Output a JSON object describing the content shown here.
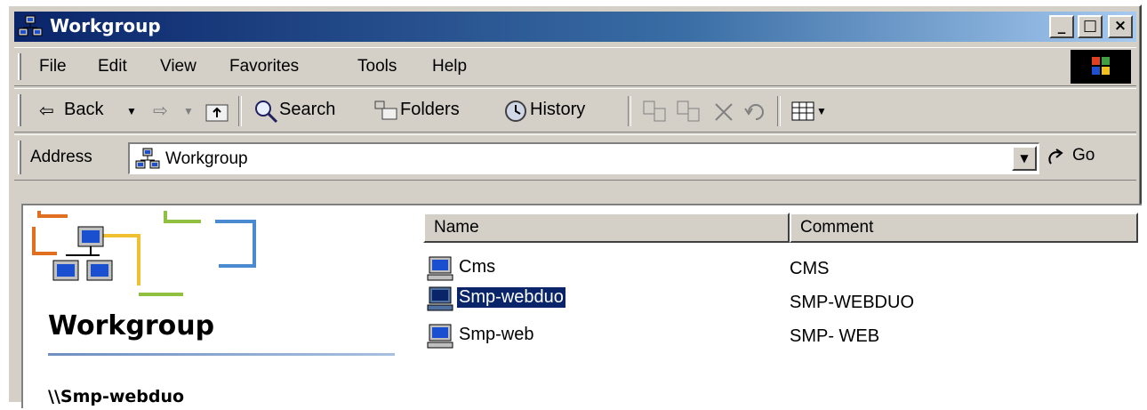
{
  "window": {
    "title": "Workgroup",
    "controls": {
      "minimize": "_",
      "maximize": "□",
      "close": "×"
    }
  },
  "menu": [
    {
      "label": "File"
    },
    {
      "label": "Edit"
    },
    {
      "label": "View"
    },
    {
      "label": "Favorites"
    },
    {
      "label": "Tools"
    },
    {
      "label": "Help"
    }
  ],
  "toolbar": {
    "back_label": "Back",
    "back_icon": "⇦",
    "forward_icon": "⇨",
    "search_label": "Search",
    "folders_label": "Folders",
    "history_label": "History"
  },
  "address": {
    "label": "Address",
    "value": "Workgroup",
    "go_label": "Go"
  },
  "left_pane": {
    "title": "Workgroup",
    "path": "\\\\Smp-webduo"
  },
  "list": {
    "columns": [
      "Name",
      "Comment"
    ],
    "rows": [
      {
        "name": "Cms",
        "comment": "CMS",
        "selected": false
      },
      {
        "name": "Smp-webduo",
        "comment": "SMP-WEBDUO",
        "selected": true
      },
      {
        "name": "Smp-web",
        "comment": "SMP- WEB",
        "selected": false
      }
    ]
  },
  "colors": {
    "title_active": "#0a246a",
    "selection": "#0a246a",
    "face": "#d4d0c8"
  }
}
